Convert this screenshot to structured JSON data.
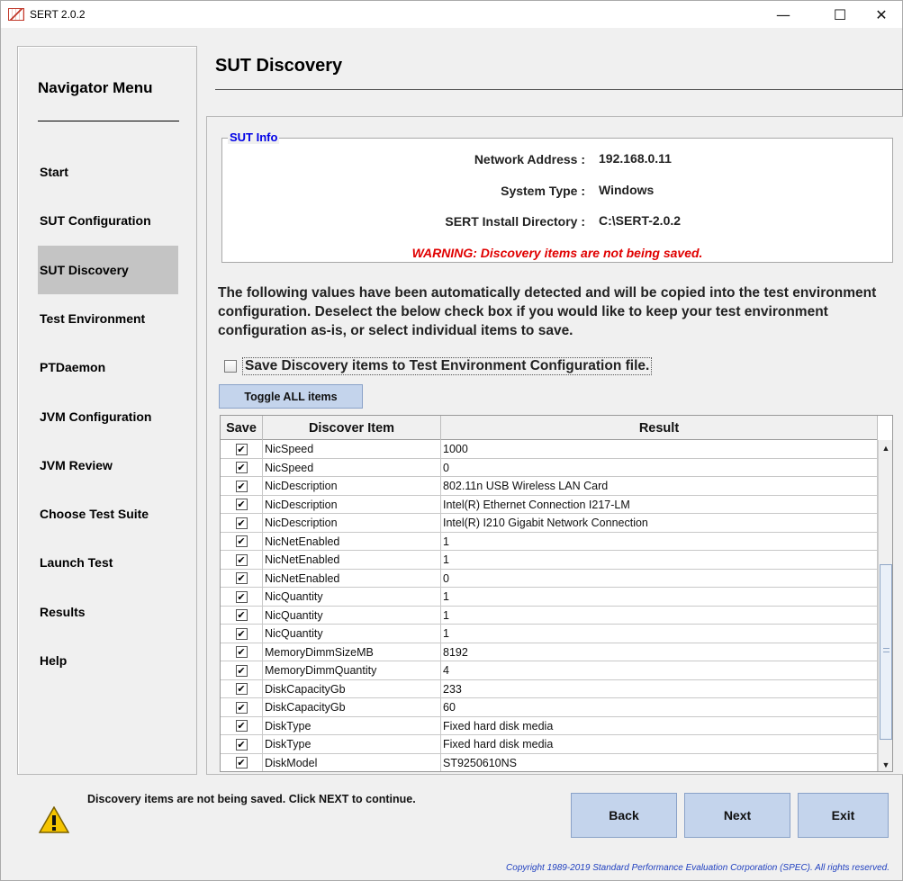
{
  "window": {
    "title": "SERT 2.0.2",
    "minimize_glyph": "—",
    "maximize_glyph": "☐",
    "close_glyph": "✕"
  },
  "nav": {
    "title": "Navigator Menu",
    "items": [
      {
        "label": "Start"
      },
      {
        "label": "SUT Configuration"
      },
      {
        "label": "SUT Discovery",
        "active": true
      },
      {
        "label": "Test Environment"
      },
      {
        "label": "PTDaemon"
      },
      {
        "label": "JVM Configuration"
      },
      {
        "label": "JVM Review"
      },
      {
        "label": "Choose Test Suite"
      },
      {
        "label": "Launch Test"
      },
      {
        "label": "Results"
      },
      {
        "label": "Help"
      }
    ]
  },
  "page": {
    "title": "SUT Discovery"
  },
  "sut_info": {
    "legend": "SUT Info",
    "network_label": "Network Address :",
    "network_value": "192.168.0.11",
    "system_label": "System Type :",
    "system_value": "Windows",
    "dir_label": "SERT Install Directory :",
    "dir_value": "C:\\SERT-2.0.2",
    "warning": "WARNING: Discovery items are not being saved."
  },
  "description": "The following values have been automatically detected and will be copied into the test environment configuration. Deselect the below check box if you would like to keep your test environment configuration as-is, or select individual items to save.",
  "save_checkbox": {
    "label": "Save Discovery items to Test Environment Configuration file.",
    "checked": false
  },
  "toggle_button": "Toggle ALL items",
  "table": {
    "headers": {
      "save": "Save",
      "item": "Discover Item",
      "result": "Result"
    },
    "check_glyph": "✔",
    "rows": [
      {
        "item": "NicSpeed",
        "result": "1000"
      },
      {
        "item": "NicSpeed",
        "result": "0"
      },
      {
        "item": "NicDescription",
        "result": "802.11n USB Wireless LAN Card"
      },
      {
        "item": "NicDescription",
        "result": "Intel(R) Ethernet Connection I217-LM"
      },
      {
        "item": "NicDescription",
        "result": "Intel(R) I210 Gigabit Network Connection"
      },
      {
        "item": "NicNetEnabled",
        "result": "1"
      },
      {
        "item": "NicNetEnabled",
        "result": "1"
      },
      {
        "item": "NicNetEnabled",
        "result": "0"
      },
      {
        "item": "NicQuantity",
        "result": "1"
      },
      {
        "item": "NicQuantity",
        "result": "1"
      },
      {
        "item": "NicQuantity",
        "result": "1"
      },
      {
        "item": "MemoryDimmSizeMB",
        "result": "8192"
      },
      {
        "item": "MemoryDimmQuantity",
        "result": "4"
      },
      {
        "item": "DiskCapacityGb",
        "result": "233"
      },
      {
        "item": "DiskCapacityGb",
        "result": "60"
      },
      {
        "item": "DiskType",
        "result": "Fixed hard disk media"
      },
      {
        "item": "DiskType",
        "result": "Fixed hard disk media"
      },
      {
        "item": "DiskModel",
        "result": "ST9250610NS"
      }
    ],
    "scroll_up_glyph": "▲",
    "scroll_down_glyph": "▼"
  },
  "status": {
    "message": "Discovery items are not being saved. Click NEXT to continue."
  },
  "buttons": {
    "back": "Back",
    "next": "Next",
    "exit": "Exit"
  },
  "copyright": "Copyright 1989-2019 Standard Performance Evaluation Corporation (SPEC). All rights reserved.",
  "colors": {
    "accent_blue": "#0000e6",
    "warning_red": "#e00000",
    "button_bg": "#c4d4ec",
    "nav_active": "#c4c4c4"
  }
}
